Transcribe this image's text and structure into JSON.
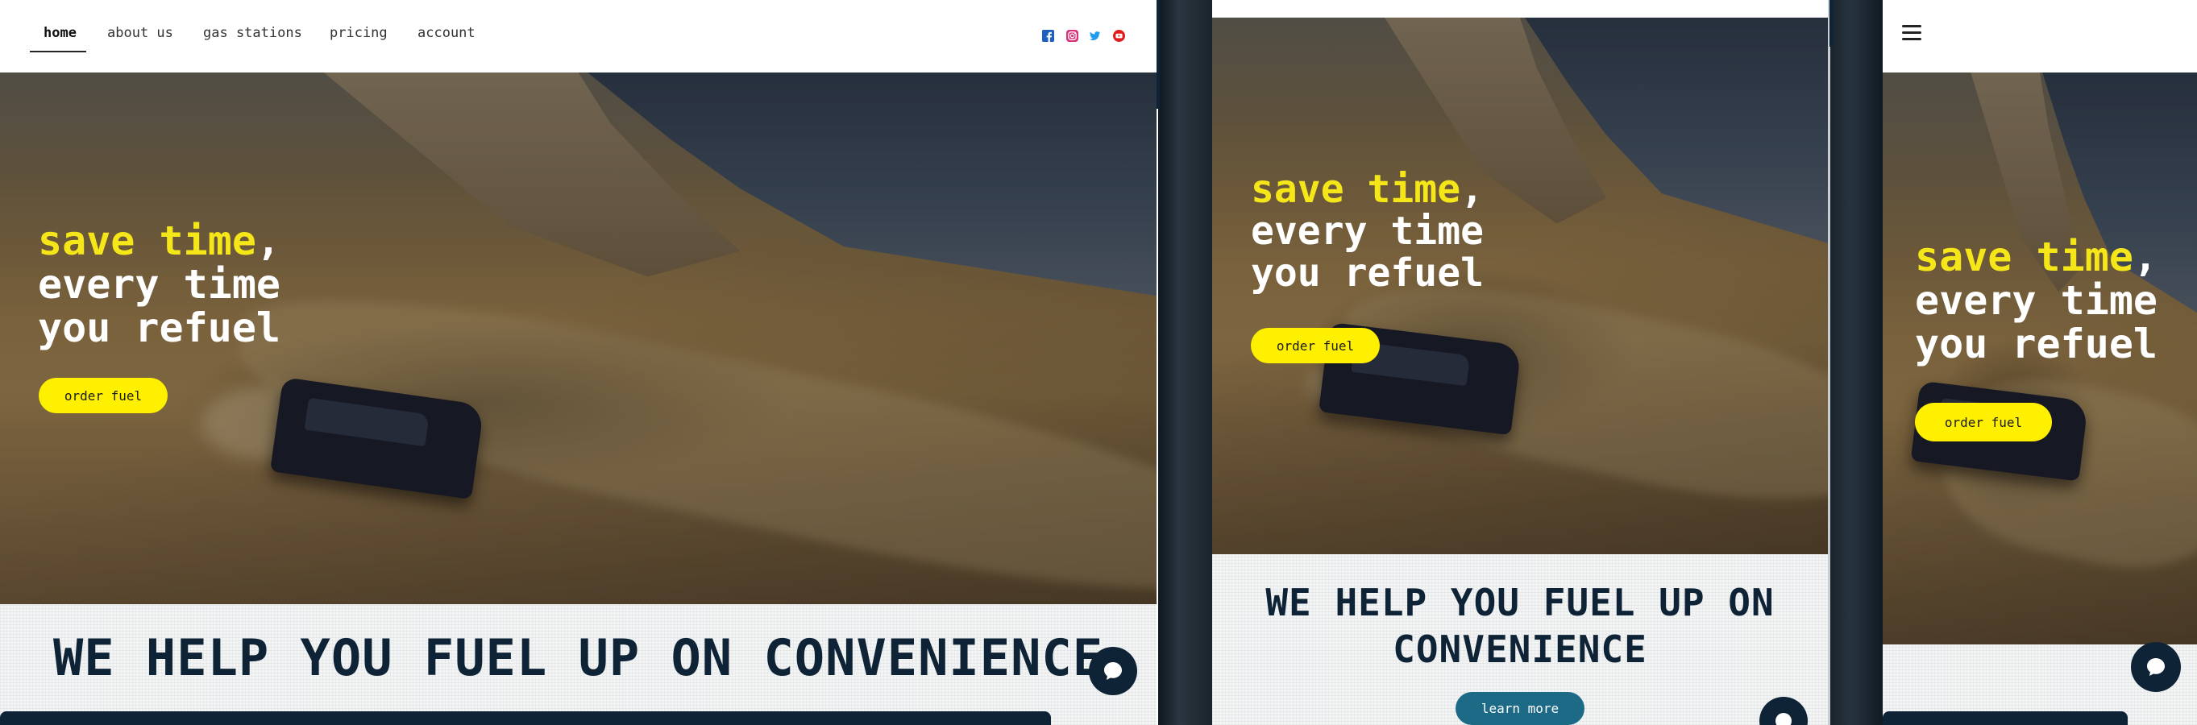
{
  "nav": {
    "links": [
      "home",
      "about us",
      "gas stations",
      "pricing",
      "account"
    ]
  },
  "social_icons": [
    "facebook-icon",
    "instagram-icon",
    "twitter-icon",
    "youtube-icon"
  ],
  "hero": {
    "line1_highlight": "save time",
    "line1_rest": ",",
    "line2": "every time",
    "line3": "you refuel",
    "cta_label": "order fuel"
  },
  "section": {
    "headline": "WE HELP YOU FUEL UP ON CONVENIENCE",
    "learn_more_label": "learn more"
  },
  "colors": {
    "accent": "#fff000",
    "highlight_text": "#f4e618",
    "navy": "#0f2336",
    "teal_button": "#1c6a86"
  }
}
